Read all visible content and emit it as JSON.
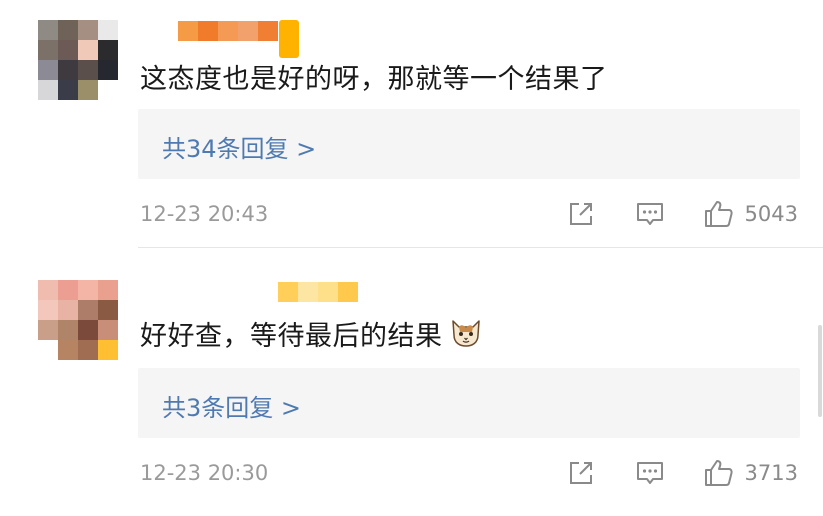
{
  "comments": [
    {
      "text": "这态度也是好的呀，那就等一个结果了",
      "replies_label": "共34条回复 >",
      "timestamp": "12-23 20:43",
      "like_count": "5043",
      "has_emoji": false,
      "avatar_pixels": [
        "#8f8a84",
        "#6f6258",
        "#a48f82",
        "#e9e9e9",
        "#7b7168",
        "#6b5a55",
        "#f1c9b8",
        "#2b2b2e",
        "#8b8a95",
        "#3e3a3f",
        "#5a4f4b",
        "#262830",
        "#d7d7da",
        "#3a3c48",
        "#9b8f6a",
        "#ffffff"
      ],
      "username_pixels": [
        "#f59b46",
        "#f07b2a",
        "#f49a54",
        "#f2a16c",
        "#f07f33"
      ]
    },
    {
      "text": "好好查，等待最后的结果",
      "replies_label": "共3条回复 >",
      "timestamp": "12-23 20:30",
      "like_count": "3713",
      "has_emoji": true,
      "emoji_name": "cat-face-emoji",
      "avatar_pixels": [
        "#f0bcb0",
        "#ec9e92",
        "#f4b4a6",
        "#eaa08e",
        "#f4c7bc",
        "#e8b3a5",
        "#ad7d69",
        "#8b5a43",
        "#c99f8a",
        "#b08468",
        "#7c4a3b",
        "#c88e77",
        "#ffffff",
        "#b78463",
        "#a06c52",
        "#ffbf33"
      ],
      "username_pixels": [
        "#ffcf5a",
        "#fde6a4",
        "#ffe08a",
        "#ffc94d"
      ]
    }
  ],
  "icons": {
    "share": "share-icon",
    "comment": "comment-icon",
    "like": "thumbs-up-icon"
  },
  "colors": {
    "reply_link": "#4f7ab0",
    "badge": "#ffb300"
  }
}
